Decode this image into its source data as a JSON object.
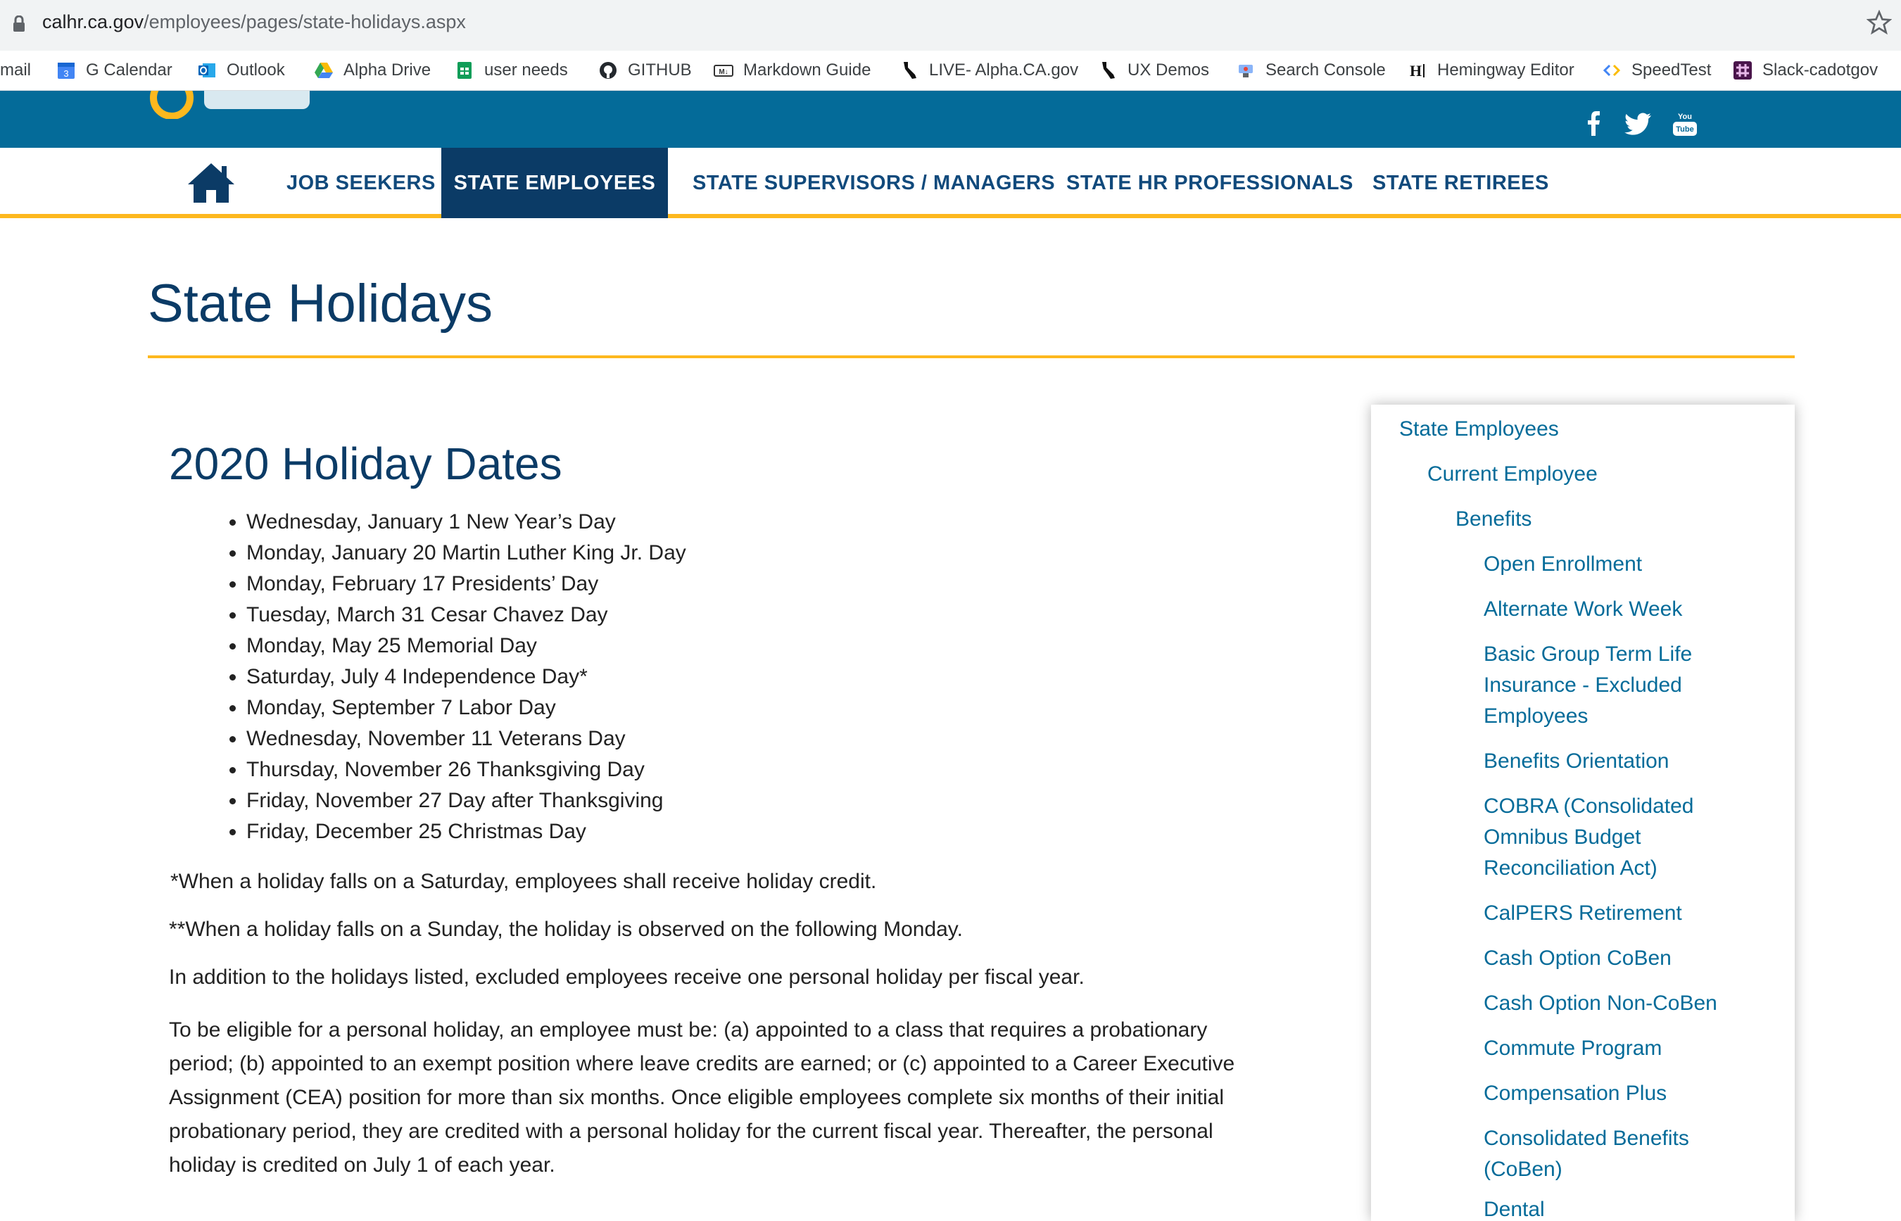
{
  "browser": {
    "url_host": "calhr.ca.gov",
    "url_path": "/employees/pages/state-holidays.aspx",
    "bookmarks": [
      {
        "label": "mail",
        "icon": "gmail-icon"
      },
      {
        "label": "G Calendar",
        "icon": "calendar-icon"
      },
      {
        "label": "Outlook",
        "icon": "outlook-icon"
      },
      {
        "label": "Alpha Drive",
        "icon": "drive-icon"
      },
      {
        "label": "user needs",
        "icon": "sheets-icon"
      },
      {
        "label": "GITHUB",
        "icon": "github-icon"
      },
      {
        "label": "Markdown Guide",
        "icon": "markdown-icon"
      },
      {
        "label": "LIVE- Alpha.CA.gov",
        "icon": "california-icon"
      },
      {
        "label": "UX Demos",
        "icon": "california-icon"
      },
      {
        "label": "Search Console",
        "icon": "search-console-icon"
      },
      {
        "label": "Hemingway Editor",
        "icon": "hemingway-icon"
      },
      {
        "label": "SpeedTest",
        "icon": "speedtest-icon"
      },
      {
        "label": "Slack-cadotgov",
        "icon": "slack-icon"
      }
    ]
  },
  "header": {
    "social": [
      "facebook-icon",
      "twitter-icon",
      "youtube-icon"
    ]
  },
  "nav": {
    "items": [
      {
        "label": "JOB SEEKERS"
      },
      {
        "label": "STATE EMPLOYEES"
      },
      {
        "label": "STATE SUPERVISORS / MANAGERS"
      },
      {
        "label": "STATE HR PROFESSIONALS"
      },
      {
        "label": "STATE RETIREES"
      }
    ]
  },
  "main": {
    "title": "State Holidays",
    "section_title": "2020 Holiday Dates",
    "holidays": [
      "Wednesday, January 1 New Year’s Day",
      "Monday, January 20 Martin Luther King Jr. Day",
      "Monday, February 17 Presidents’ Day",
      "Tuesday, March 31 Cesar Chavez Day",
      "Monday, May 25 Memorial Day",
      "Saturday, July 4 Independence Day*",
      "Monday, September 7 Labor Day",
      "Wednesday, November 11 Veterans Day",
      "Thursday, November 26 Thanksgiving Day",
      "Friday, November 27 Day after Thanksgiving",
      "Friday, December 25 Christmas Day"
    ],
    "note_saturday": "*When a holiday falls on a Saturday, employees shall receive holiday credit.",
    "note_sunday": "**When a holiday falls on a Sunday, the holiday is observed on the following Monday.",
    "personal_holiday": "In addition to the holidays listed, excluded employees receive one personal holiday per fiscal year.",
    "eligibility": "To be eligible for a personal holiday, an employee must be: (a) appointed to a class that requires a probationary period; (b) appointed to an exempt position where leave credits are earned; or (c) appointed to a Career Executive Assignment (CEA) position for more than six months.  Once eligible employees complete six months of their initial probationary period, they are credited with a personal holiday for the current fiscal year.  Thereafter, the personal holiday is credited on July 1 of each year."
  },
  "sidebar": {
    "items": [
      {
        "label": "State Employees"
      },
      {
        "label": "Current Employee"
      },
      {
        "label": "Benefits"
      },
      {
        "label": "Open Enrollment"
      },
      {
        "label": "Alternate Work Week"
      },
      {
        "label": "Basic Group Term Life Insurance - Excluded Employees"
      },
      {
        "label": "Benefits Orientation"
      },
      {
        "label": "COBRA (Consolidated Omnibus Budget Reconciliation Act)"
      },
      {
        "label": "CalPERS Retirement"
      },
      {
        "label": "Cash Option CoBen"
      },
      {
        "label": "Cash Option Non-CoBen"
      },
      {
        "label": "Commute Program"
      },
      {
        "label": "Compensation Plus"
      },
      {
        "label": "Consolidated Benefits (CoBen)"
      },
      {
        "label": "Dental"
      }
    ]
  },
  "colors": {
    "brand_blue": "#046b99",
    "navy": "#0b3b66",
    "accent_gold": "#fdb81e"
  }
}
